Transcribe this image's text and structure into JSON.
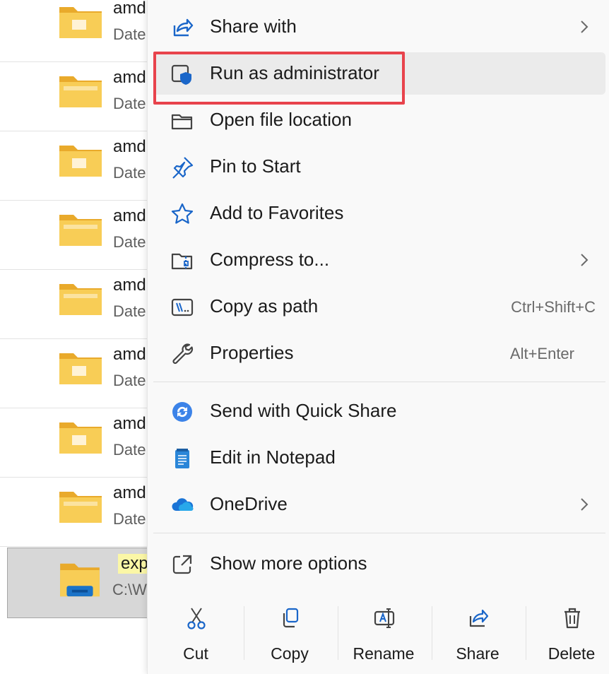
{
  "files": [
    {
      "name": "amd",
      "subtitle": "Date"
    },
    {
      "name": "amd",
      "subtitle": "Date"
    },
    {
      "name": "amd",
      "subtitle": "Date"
    },
    {
      "name": "amd",
      "subtitle": "Date"
    },
    {
      "name": "amd",
      "subtitle": "Date"
    },
    {
      "name": "amd",
      "subtitle": "Date"
    },
    {
      "name": "amd",
      "subtitle": "Date"
    },
    {
      "name": "amd",
      "subtitle": "Date"
    }
  ],
  "selected_file": {
    "name": "exp",
    "subtitle": "C:\\W"
  },
  "menu": {
    "items": [
      {
        "label": "Share with",
        "icon": "share-icon"
      },
      {
        "label": "Run as administrator",
        "icon": "shield-icon"
      },
      {
        "label": "Open file location",
        "icon": "folder-open-icon"
      },
      {
        "label": "Pin to Start",
        "icon": "pin-icon"
      },
      {
        "label": "Add to Favorites",
        "icon": "star-icon"
      },
      {
        "label": "Compress to...",
        "icon": "zip-icon"
      },
      {
        "label": "Copy as path",
        "icon": "copy-path-icon",
        "shortcut": "Ctrl+Shift+C"
      },
      {
        "label": "Properties",
        "icon": "wrench-icon",
        "shortcut": "Alt+Enter"
      },
      {
        "label": "Send with Quick Share",
        "icon": "quick-share-icon"
      },
      {
        "label": "Edit in Notepad",
        "icon": "notepad-icon"
      },
      {
        "label": "OneDrive",
        "icon": "onedrive-icon"
      },
      {
        "label": "Show more options",
        "icon": "open-external-icon"
      }
    ],
    "actions": [
      {
        "label": "Cut",
        "icon": "scissors-icon"
      },
      {
        "label": "Copy",
        "icon": "copy-icon"
      },
      {
        "label": "Rename",
        "icon": "rename-icon"
      },
      {
        "label": "Share",
        "icon": "share-icon"
      },
      {
        "label": "Delete",
        "icon": "trash-icon"
      }
    ]
  },
  "colors": {
    "accent": "#0067c0",
    "highlight": "#e8434c",
    "folder": "#f5c342",
    "selected_row": "#d7d7d7"
  }
}
